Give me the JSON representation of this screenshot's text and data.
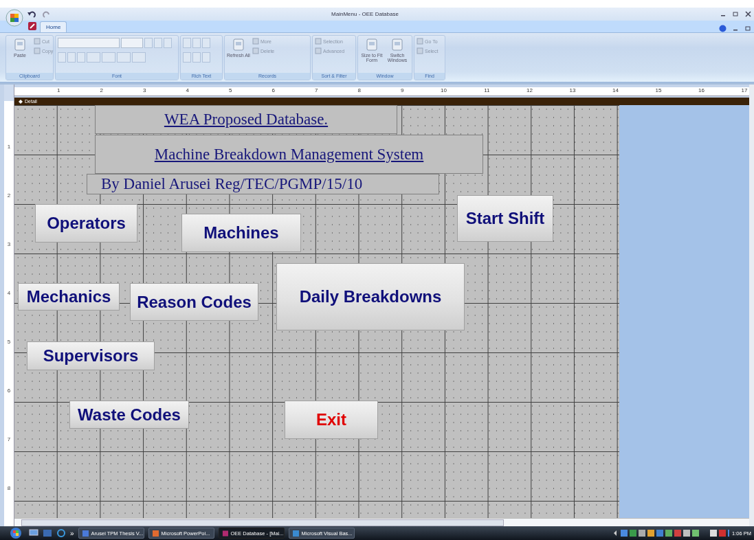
{
  "window": {
    "title": "MainMenu - OEE Database"
  },
  "tabs": [
    {
      "label": "Home",
      "selected": true
    }
  ],
  "ribbon": {
    "groups": [
      {
        "label": "Clipboard",
        "items": [
          {
            "kind": "big",
            "label": "Paste"
          },
          {
            "kind": "small",
            "label": "Cut"
          },
          {
            "kind": "small",
            "label": "Copy"
          }
        ]
      },
      {
        "label": "Font",
        "items": [
          {
            "kind": "font"
          }
        ]
      },
      {
        "label": "Rich Text",
        "items": [
          {
            "kind": "rich"
          }
        ]
      },
      {
        "label": "Records",
        "items": [
          {
            "kind": "big",
            "label": "Refresh All"
          },
          {
            "kind": "small",
            "label": "More"
          },
          {
            "kind": "small",
            "label": "Delete"
          }
        ]
      },
      {
        "label": "Sort & Filter",
        "items": [
          {
            "kind": "small",
            "label": "Selection"
          },
          {
            "kind": "small",
            "label": "Advanced"
          }
        ]
      },
      {
        "label": "Window",
        "items": [
          {
            "kind": "big",
            "label": "Size to Fit Form"
          },
          {
            "kind": "big",
            "label": "Switch Windows"
          }
        ]
      },
      {
        "label": "Find",
        "items": [
          {
            "kind": "small",
            "label": "Go To"
          },
          {
            "kind": "small",
            "label": "Select"
          }
        ]
      }
    ]
  },
  "ruler": {
    "horizontal": [
      "1",
      "2",
      "3",
      "4",
      "5",
      "6",
      "7",
      "8",
      "9",
      "10",
      "11",
      "12",
      "13",
      "14",
      "15",
      "16",
      "17"
    ],
    "vertical": [
      "1",
      "2",
      "3",
      "4",
      "5",
      "6",
      "7",
      "8"
    ]
  },
  "section": {
    "title": "Detail"
  },
  "labels": [
    {
      "text": "WEA Proposed Database."
    },
    {
      "text": "Machine Breakdown Management System"
    },
    {
      "text": "By Daniel Arusei Reg/TEC/PGMP/15/10"
    }
  ],
  "buttons": [
    {
      "label": "Operators",
      "color": "#10107a"
    },
    {
      "label": "Machines",
      "color": "#10107a"
    },
    {
      "label": "Start Shift",
      "color": "#10107a"
    },
    {
      "label": "Mechanics",
      "color": "#10107a"
    },
    {
      "label": "Reason Codes",
      "color": "#10107a"
    },
    {
      "label": "Daily Breakdowns",
      "color": "#10107a"
    },
    {
      "label": "Supervisors",
      "color": "#10107a"
    },
    {
      "label": "Waste Codes",
      "color": "#10107a"
    },
    {
      "label": "Exit",
      "color": "#e00000"
    }
  ],
  "taskbar": {
    "more": "»",
    "tasks": [
      {
        "label": "Arusei TPM Thesis V...",
        "selected": false
      },
      {
        "label": "Microsoft PowerPoi...",
        "selected": false
      },
      {
        "label": "OEE Database - [Mai...",
        "selected": true
      },
      {
        "label": "Microsoft Visual Bas...",
        "selected": false
      }
    ],
    "clock": "1:06 PM"
  }
}
